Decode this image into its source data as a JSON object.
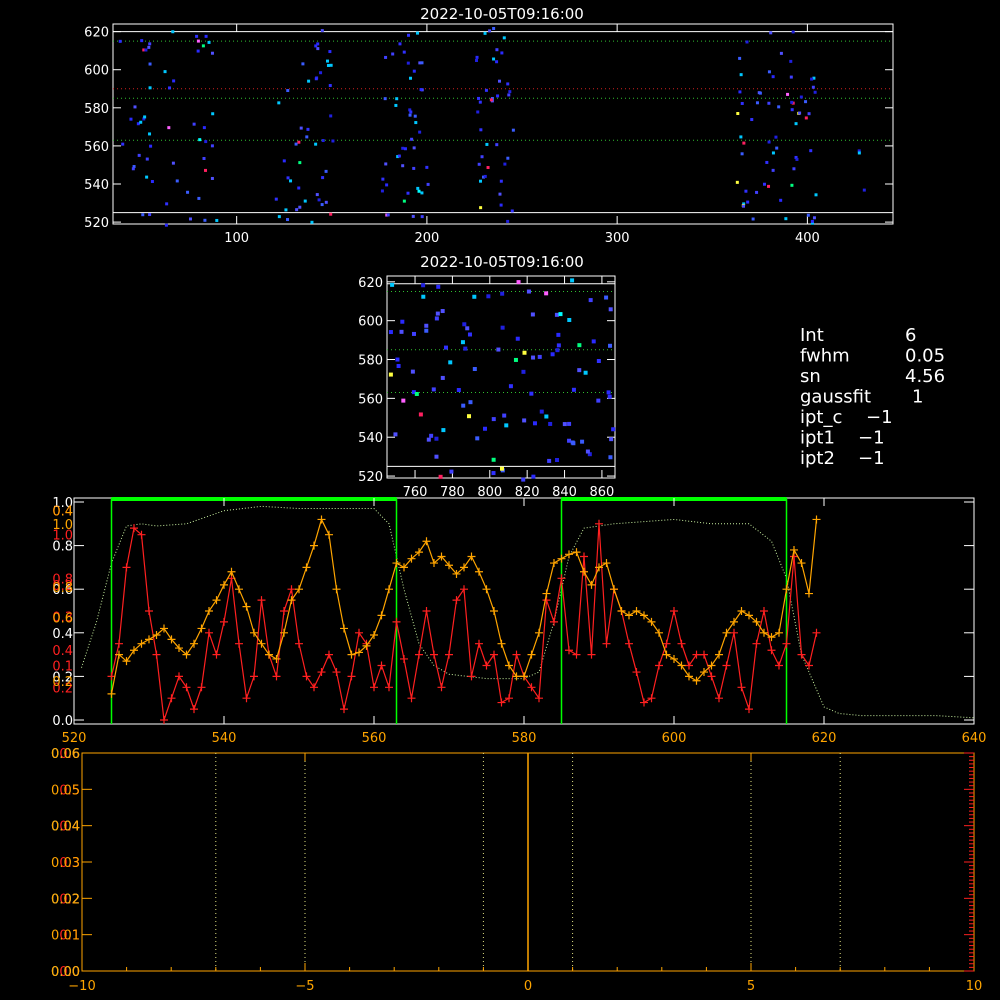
{
  "colors": {
    "background": "#000000",
    "axis": "#ffffff",
    "orange": "#ffa500",
    "red": "#ff2020",
    "green": "#00ff00",
    "dotted_green": "#30c030",
    "dotted_red": "#d02020",
    "pale_green": "#c8f0a0",
    "yellow_dots": "#e0e080"
  },
  "panel_top": {
    "title": "2022-10-05T09:16:00",
    "xlim": [
      35,
      445
    ],
    "ylim": [
      519,
      624
    ],
    "x_ticks": [
      100,
      200,
      300,
      400
    ],
    "y_ticks": [
      520,
      540,
      560,
      580,
      600,
      620
    ],
    "hlines_solid": [
      620,
      525
    ],
    "hlines_green_dotted": [
      615,
      585,
      563
    ],
    "hlines_red_dotted": [
      590
    ]
  },
  "panel_mid": {
    "title": "2022-10-05T09:16:00",
    "xlim": [
      745,
      867
    ],
    "ylim": [
      519,
      623
    ],
    "x_ticks": [
      760,
      780,
      800,
      820,
      840,
      860
    ],
    "y_ticks": [
      520,
      540,
      560,
      580,
      600,
      620
    ],
    "hlines_solid": [
      619,
      525
    ],
    "hlines_green_dotted": [
      615,
      585,
      563
    ]
  },
  "info_text": [
    {
      "label": "Int",
      "value": "6"
    },
    {
      "label": "fwhm",
      "value": "0.05"
    },
    {
      "label": "sn",
      "value": "4.56"
    },
    {
      "label": "gaussfit",
      "value": "1"
    },
    {
      "label": "ipt_c",
      "value": "−1"
    },
    {
      "label": "ipt1",
      "value": "−1"
    },
    {
      "label": "ipt2",
      "value": "−1"
    }
  ],
  "chart_data": [
    {
      "type": "line",
      "xlim": [
        520,
        640
      ],
      "ylim": [
        0.0,
        1.0
      ],
      "x_ticks": [
        520,
        540,
        560,
        580,
        600,
        620,
        640
      ],
      "y_ticks_white": [
        "0.0",
        "0.2",
        "0.4",
        "0.6",
        "0.8",
        "1.0"
      ],
      "y_ticks_white_values": [
        0.0,
        0.2,
        0.4,
        0.6,
        0.8,
        1.0
      ],
      "y_ticks_red": [
        "0.2",
        "0.1",
        "0.4",
        "0.3",
        "0.2",
        "0.8",
        "1.0",
        "0.4"
      ],
      "y_ticks_red_values": [
        0.15,
        0.25,
        0.32,
        0.475,
        0.62,
        0.65,
        0.85,
        0.96
      ],
      "y_ticks_orange": [
        "0.2",
        "0.6",
        "0.8",
        "1.0",
        "0.4"
      ],
      "y_ticks_orange_values": [
        0.18,
        0.47,
        0.61,
        0.9,
        0.96
      ],
      "green_boxes": [
        [
          525,
          563
        ],
        [
          585,
          615
        ]
      ],
      "dotted_profile_x": [
        521,
        523,
        525,
        527,
        529,
        531,
        535,
        540,
        545,
        550,
        555,
        560,
        562,
        564,
        566,
        568,
        570,
        575,
        580,
        582,
        584,
        586,
        588,
        592,
        600,
        605,
        610,
        613,
        615,
        617,
        620,
        622,
        625,
        630,
        635,
        640
      ],
      "dotted_profile_y": [
        0.24,
        0.45,
        0.72,
        0.89,
        0.9,
        0.89,
        0.9,
        0.96,
        0.98,
        0.97,
        0.97,
        0.97,
        0.9,
        0.6,
        0.35,
        0.25,
        0.21,
        0.19,
        0.19,
        0.22,
        0.45,
        0.75,
        0.88,
        0.9,
        0.92,
        0.9,
        0.9,
        0.82,
        0.65,
        0.3,
        0.06,
        0.03,
        0.02,
        0.02,
        0.02,
        0.01
      ],
      "orange_x": [
        525,
        526,
        527,
        528,
        529,
        530,
        531,
        532,
        533,
        534,
        535,
        536,
        537,
        538,
        539,
        540,
        541,
        542,
        543,
        544,
        545,
        546,
        547,
        548,
        549,
        550,
        551,
        552,
        553,
        554,
        555,
        556,
        557,
        558,
        559,
        560,
        561,
        562,
        563,
        564,
        565,
        566,
        567,
        568,
        569,
        570,
        571,
        572,
        573,
        574,
        575,
        576,
        577,
        578,
        579,
        580,
        581,
        582,
        583,
        584,
        585,
        586,
        587,
        588,
        589,
        590,
        591,
        592,
        593,
        594,
        595,
        596,
        597,
        598,
        599,
        600,
        601,
        602,
        603,
        604,
        605,
        606,
        607,
        608,
        609,
        610,
        611,
        612,
        613,
        614,
        615,
        616,
        617,
        618,
        619
      ],
      "orange_y": [
        0.12,
        0.3,
        0.27,
        0.32,
        0.35,
        0.37,
        0.39,
        0.42,
        0.37,
        0.33,
        0.3,
        0.35,
        0.42,
        0.5,
        0.55,
        0.62,
        0.68,
        0.6,
        0.52,
        0.4,
        0.35,
        0.3,
        0.28,
        0.4,
        0.55,
        0.6,
        0.7,
        0.8,
        0.92,
        0.85,
        0.6,
        0.42,
        0.3,
        0.31,
        0.34,
        0.39,
        0.48,
        0.6,
        0.72,
        0.7,
        0.74,
        0.77,
        0.82,
        0.72,
        0.75,
        0.71,
        0.67,
        0.7,
        0.75,
        0.68,
        0.6,
        0.5,
        0.35,
        0.25,
        0.2,
        0.2,
        0.3,
        0.4,
        0.58,
        0.72,
        0.74,
        0.76,
        0.77,
        0.68,
        0.62,
        0.7,
        0.72,
        0.6,
        0.5,
        0.48,
        0.5,
        0.48,
        0.45,
        0.4,
        0.3,
        0.28,
        0.25,
        0.2,
        0.18,
        0.22,
        0.25,
        0.3,
        0.4,
        0.45,
        0.5,
        0.48,
        0.45,
        0.4,
        0.38,
        0.4,
        0.6,
        0.78,
        0.72,
        0.58,
        0.92
      ],
      "red_x": [
        525,
        526,
        527,
        528,
        529,
        530,
        531,
        532,
        533,
        534,
        535,
        536,
        537,
        538,
        539,
        540,
        541,
        542,
        543,
        544,
        545,
        546,
        547,
        548,
        549,
        550,
        551,
        552,
        553,
        554,
        555,
        556,
        557,
        558,
        559,
        560,
        561,
        562,
        563,
        564,
        565,
        566,
        567,
        568,
        569,
        570,
        571,
        572,
        573,
        574,
        575,
        576,
        577,
        578,
        579,
        580,
        581,
        582,
        583,
        584,
        585,
        586,
        587,
        588,
        589,
        590,
        591,
        592,
        593,
        594,
        595,
        596,
        597,
        598,
        599,
        600,
        601,
        602,
        603,
        604,
        605,
        606,
        607,
        608,
        609,
        610,
        611,
        612,
        613,
        614,
        615,
        616,
        617,
        618,
        619
      ],
      "red_y": [
        0.2,
        0.35,
        0.7,
        0.88,
        0.85,
        0.5,
        0.3,
        0.0,
        0.1,
        0.2,
        0.15,
        0.05,
        0.15,
        0.4,
        0.3,
        0.45,
        0.65,
        0.35,
        0.1,
        0.2,
        0.55,
        0.3,
        0.2,
        0.5,
        0.6,
        0.35,
        0.2,
        0.15,
        0.22,
        0.3,
        0.22,
        0.05,
        0.2,
        0.4,
        0.35,
        0.15,
        0.25,
        0.15,
        0.45,
        0.28,
        0.1,
        0.3,
        0.5,
        0.3,
        0.15,
        0.3,
        0.55,
        0.6,
        0.2,
        0.35,
        0.25,
        0.3,
        0.08,
        0.1,
        0.3,
        0.2,
        0.15,
        0.1,
        0.55,
        0.45,
        0.65,
        0.32,
        0.3,
        0.75,
        0.3,
        0.9,
        0.35,
        0.6,
        0.5,
        0.35,
        0.22,
        0.08,
        0.1,
        0.25,
        0.35,
        0.5,
        0.35,
        0.25,
        0.3,
        0.3,
        0.2,
        0.1,
        0.25,
        0.4,
        0.15,
        0.05,
        0.35,
        0.5,
        0.32,
        0.25,
        0.35,
        0.75,
        0.3,
        0.25,
        0.4
      ]
    },
    {
      "type": "line",
      "xlim": [
        -10,
        10
      ],
      "ylim": [
        0.0,
        0.06
      ],
      "x_ticks": [
        -10,
        -5,
        0,
        5,
        10
      ],
      "y_ticks_orange": [
        "0.00",
        "0.01",
        "0.02",
        "0.03",
        "0.04",
        "0.05",
        "0.06"
      ],
      "y_ticks_orange_values": [
        0.0,
        0.01,
        0.02,
        0.03,
        0.04,
        0.05,
        0.06
      ],
      "y_ticks_red": [
        "0.0",
        "0.1",
        "0.2",
        "0.3",
        "0.4",
        "0.5",
        "0.6"
      ],
      "y_ticks_red_values": [
        0.0,
        0.1,
        0.2,
        0.3,
        0.4,
        0.5,
        0.6
      ],
      "y_ticks_pale": [
        "0.00",
        "0.02",
        "0.04",
        "0.06"
      ],
      "y_ticks_pale_values": [
        0.0,
        0.02,
        0.04,
        0.06
      ],
      "vlines_dotted": [
        -7,
        -5,
        -1,
        1,
        5,
        7
      ],
      "vline_orange": 0
    }
  ]
}
